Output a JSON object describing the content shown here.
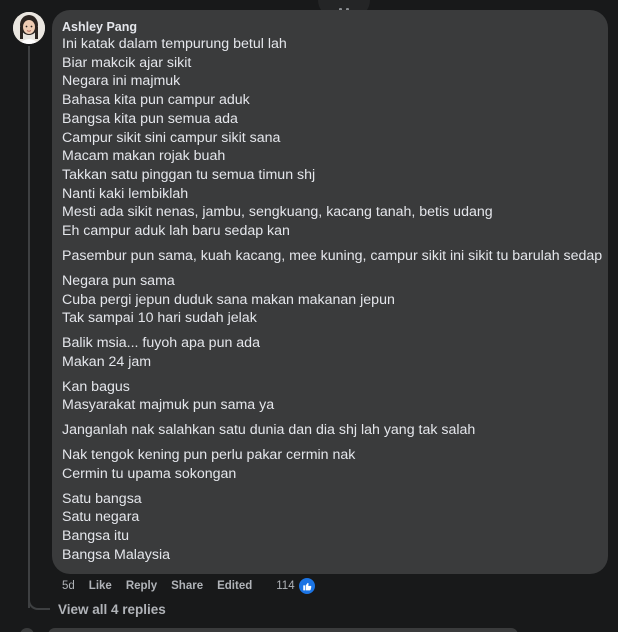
{
  "comment": {
    "author": "Ashley Pang",
    "paragraphs": [
      [
        "Ini katak dalam tempurung betul lah",
        "Biar makcik ajar sikit",
        "Negara ini majmuk",
        "Bahasa kita pun campur aduk",
        "Bangsa kita pun semua ada",
        "Campur sikit sini campur sikit sana",
        "Macam makan rojak buah",
        "Takkan satu pinggan tu semua timun shj",
        "Nanti kaki lembiklah",
        "Mesti ada sikit nenas, jambu, sengkuang, kacang tanah, betis udang",
        "Eh campur aduk lah baru sedap kan"
      ],
      [
        "Pasembur pun sama, kuah kacang, mee kuning, campur sikit ini sikit tu barulah sedap"
      ],
      [
        "Negara pun sama",
        "Cuba pergi jepun duduk sana makan makanan jepun",
        "Tak sampai 10 hari sudah jelak"
      ],
      [
        "Balik msia... fuyoh apa pun ada",
        "Makan 24 jam"
      ],
      [
        "Kan bagus",
        "Masyarakat majmuk pun sama ya"
      ],
      [
        "Janganlah nak salahkan satu dunia dan dia shj lah yang tak salah"
      ],
      [
        "Nak tengok kening pun perlu pakar cermin nak",
        "Cermin tu upama sokongan"
      ],
      [
        "Satu bangsa",
        "Satu negara",
        "Bangsa itu",
        "Bangsa Malaysia"
      ]
    ],
    "timestamp": "5d",
    "actions": {
      "like": "Like",
      "reply": "Reply",
      "share": "Share",
      "edited": "Edited"
    },
    "reaction_count": "114",
    "reaction_icon": "thumbs-up-icon",
    "view_replies": "View all 4 replies"
  },
  "colors": {
    "background": "#18191a",
    "bubble": "#3a3b3c",
    "text": "#e4e6eb",
    "secondary_text": "#b0b3b8",
    "like_blue": "#1b74e4"
  }
}
